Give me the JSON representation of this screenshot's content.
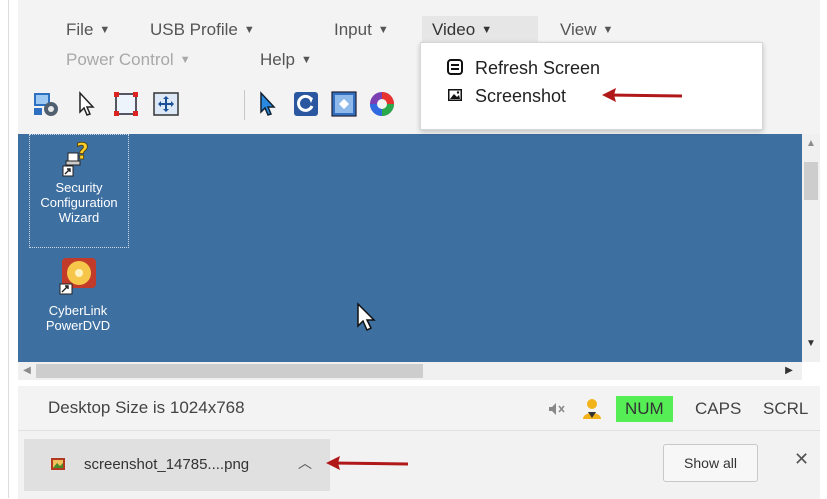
{
  "menu": {
    "file": "File",
    "usb_profile": "USB Profile",
    "input": "Input",
    "video": "Video",
    "view": "View",
    "power_control": "Power Control",
    "help": "Help"
  },
  "video_menu": {
    "items": [
      {
        "label": "Refresh Screen",
        "icon": "refresh-screen-icon"
      },
      {
        "label": "Screenshot",
        "icon": "screenshot-icon"
      }
    ]
  },
  "toolbar": {
    "icons": [
      "remote-settings-icon",
      "cursor-icon",
      "full-screen-icon",
      "fit-to-window-icon",
      "pointer-mode-icon",
      "refresh-icon",
      "auto-adjust-icon",
      "color-icon"
    ]
  },
  "desktop": {
    "icons": [
      {
        "lines": [
          "Security",
          "Configuration",
          "Wizard"
        ],
        "icon": "security-wizard-icon"
      },
      {
        "lines": [
          "CyberLink",
          "PowerDVD"
        ],
        "icon": "powerdvd-icon"
      }
    ]
  },
  "status": {
    "desktop_size": "Desktop Size is 1024x768",
    "num": "NUM",
    "caps": "CAPS",
    "scrl": "SCRL",
    "colors": {
      "num_active": "#55ee55"
    }
  },
  "downloads": {
    "filename": "screenshot_14785....png",
    "show_all": "Show all"
  },
  "colors": {
    "desktop_bg": "#3d6fa0",
    "annotation_arrow": "#b0181a"
  }
}
